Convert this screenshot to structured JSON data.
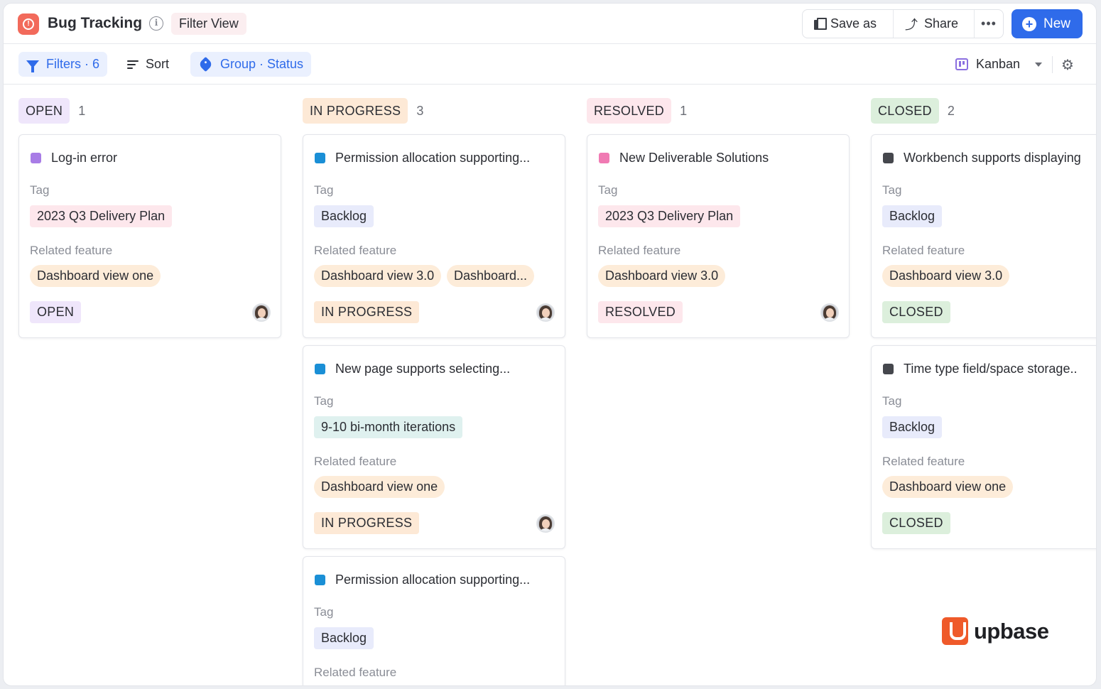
{
  "header": {
    "title": "Bug Tracking",
    "view_name": "Filter View",
    "save_as": "Save as",
    "share": "Share",
    "more": "•••",
    "new": "New"
  },
  "toolbar": {
    "filters": "Filters · 6",
    "sort": "Sort",
    "group": "Group · Status",
    "view_mode": "Kanban"
  },
  "field_labels": {
    "tag": "Tag",
    "related": "Related feature"
  },
  "colors": {
    "open": "#efe6fb",
    "in_progress": "#fde9d6",
    "resolved": "#fde7ec",
    "closed": "#dcefdc",
    "tag_delivery": "#fde7ec",
    "tag_backlog": "#e8ebfb",
    "tag_iterations": "#dff1ef",
    "accent": "#2f6bea"
  },
  "columns": [
    {
      "status": "OPEN",
      "count": "1",
      "cards": [
        {
          "title": "Log-in error",
          "dot": "#a87ce6",
          "tag": "2023 Q3 Delivery Plan",
          "features": [
            "Dashboard view one"
          ],
          "status": "OPEN",
          "avatar": true
        }
      ]
    },
    {
      "status": "IN PROGRESS",
      "count": "3",
      "cards": [
        {
          "title": "Permission allocation supporting...",
          "dot": "#1a8fd6",
          "tag": "Backlog",
          "features": [
            "Dashboard view 3.0",
            "Dashboard..."
          ],
          "status": "IN PROGRESS",
          "avatar": true
        },
        {
          "title": "New page supports selecting...",
          "dot": "#1a8fd6",
          "tag": "9-10 bi-month iterations",
          "features": [
            "Dashboard view one"
          ],
          "status": "IN PROGRESS",
          "avatar": true
        },
        {
          "title": "Permission allocation supporting...",
          "dot": "#1a8fd6",
          "tag": "Backlog",
          "features": [],
          "status": "",
          "avatar": false
        }
      ]
    },
    {
      "status": "RESOLVED",
      "count": "1",
      "cards": [
        {
          "title": "New Deliverable Solutions",
          "dot": "#f07ab3",
          "tag": "2023 Q3 Delivery Plan",
          "features": [
            "Dashboard view 3.0"
          ],
          "status": "RESOLVED",
          "avatar": true
        }
      ]
    },
    {
      "status": "CLOSED",
      "count": "2",
      "cards": [
        {
          "title": "Workbench supports displaying",
          "dot": "#45474d",
          "tag": "Backlog",
          "features": [
            "Dashboard view 3.0"
          ],
          "status": "CLOSED",
          "avatar": false
        },
        {
          "title": "Time type field/space storage..",
          "dot": "#45474d",
          "tag": "Backlog",
          "features": [
            "Dashboard view one"
          ],
          "status": "CLOSED",
          "avatar": false
        }
      ]
    }
  ],
  "brand": {
    "name": "upbase"
  }
}
